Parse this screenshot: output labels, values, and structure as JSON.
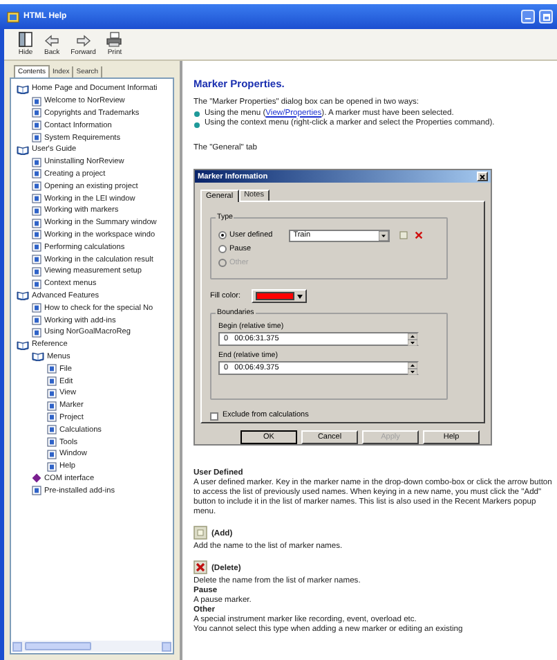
{
  "window": {
    "title": "HTML Help"
  },
  "toolbar": [
    {
      "label": "Hide",
      "kind": "hide"
    },
    {
      "label": "Back",
      "kind": "back"
    },
    {
      "label": "Forward",
      "kind": "forward"
    },
    {
      "label": "Print",
      "kind": "print"
    }
  ],
  "nav_tabs": [
    {
      "label": "Contents",
      "selected": true
    },
    {
      "label": "Index",
      "selected": false
    },
    {
      "label": "Search",
      "selected": false
    }
  ],
  "tree": [
    {
      "label": "Home Page and Document Informati",
      "kind": "book",
      "expanded": true,
      "children": [
        {
          "label": "Welcome to NorReview",
          "kind": "page"
        },
        {
          "label": "Copyrights and Trademarks",
          "kind": "page"
        },
        {
          "label": "Contact Information",
          "kind": "page"
        },
        {
          "label": "System Requirements",
          "kind": "page"
        }
      ]
    },
    {
      "label": "User's Guide",
      "kind": "book",
      "expanded": true,
      "children": [
        {
          "label": "Uninstalling NorReview",
          "kind": "page"
        },
        {
          "label": "Creating a project",
          "kind": "page"
        },
        {
          "label": "Opening an existing project",
          "kind": "page"
        },
        {
          "label": "Working in the LEI window",
          "kind": "page"
        },
        {
          "label": "Working with markers",
          "kind": "page"
        },
        {
          "label": "Working in the Summary window",
          "kind": "page"
        },
        {
          "label": "Working in the workspace windo",
          "kind": "page"
        },
        {
          "label": "Performing calculations",
          "kind": "page"
        },
        {
          "label": "Working in the calculation result",
          "kind": "page"
        },
        {
          "label": "Viewing measurement setup",
          "kind": "page"
        },
        {
          "label": "Context menus",
          "kind": "page"
        }
      ]
    },
    {
      "label": "Advanced Features",
      "kind": "book",
      "expanded": true,
      "children": [
        {
          "label": "How to check for the special No",
          "kind": "page"
        },
        {
          "label": "Working with add-ins",
          "kind": "page"
        },
        {
          "label": "Using NorGoalMacroReg",
          "kind": "page"
        }
      ]
    },
    {
      "label": "Reference",
      "kind": "book",
      "expanded": true,
      "children": [
        {
          "label": "Menus",
          "kind": "book",
          "expanded": true,
          "children": [
            {
              "label": "File",
              "kind": "page"
            },
            {
              "label": "Edit",
              "kind": "page"
            },
            {
              "label": "View",
              "kind": "page"
            },
            {
              "label": "Marker",
              "kind": "page"
            },
            {
              "label": "Project",
              "kind": "page"
            },
            {
              "label": "Calculations",
              "kind": "page"
            },
            {
              "label": "Tools",
              "kind": "page"
            },
            {
              "label": "Window",
              "kind": "page"
            },
            {
              "label": "Help",
              "kind": "page"
            }
          ]
        },
        {
          "label": "COM interface",
          "kind": "gem"
        },
        {
          "label": "Pre-installed add-ins",
          "kind": "page"
        }
      ]
    }
  ],
  "article": {
    "heading": "Marker Properties.",
    "intro": "The \"Marker Properties\" dialog box can be opened in two ways:",
    "bullets": [
      {
        "parts": [
          {
            "kind": "text",
            "text": "Using the menu ("
          },
          {
            "kind": "link",
            "text": "View/Properties"
          },
          {
            "kind": "text",
            "text": "). A marker must have been selected."
          }
        ]
      },
      {
        "parts": [
          {
            "kind": "text",
            "text": "Using the context menu (right-click a marker and select the Properties command)."
          }
        ]
      }
    ],
    "tab_caption": "The \"General\" tab",
    "dialog": {
      "title": "Marker Information",
      "tabs": [
        {
          "label": "General",
          "selected": true
        },
        {
          "label": "Notes",
          "selected": false
        }
      ],
      "type_group": {
        "label": "Type",
        "marker_name": "Train",
        "options": [
          {
            "label": "User defined",
            "selected": true,
            "disabled": false
          },
          {
            "label": "Pause",
            "selected": false,
            "disabled": false
          },
          {
            "label": "Other",
            "selected": false,
            "disabled": true
          }
        ]
      },
      "fill_color": {
        "label": "Fill color:",
        "color": "#ff0000"
      },
      "boundaries": {
        "label": "Boundaries",
        "fields": [
          {
            "label": "Begin (relative time)",
            "value": "0   00:06:31.375"
          },
          {
            "label": "End (relative time)",
            "value": "0   00:06:49.375"
          }
        ]
      },
      "exclude": {
        "label": "Exclude from calculations",
        "checked": false
      },
      "buttons": [
        {
          "label": "OK",
          "disabled": false,
          "default": true
        },
        {
          "label": "Cancel",
          "disabled": false,
          "default": false
        },
        {
          "label": "Apply",
          "disabled": true,
          "default": false
        },
        {
          "label": "Help",
          "disabled": false,
          "default": false
        }
      ]
    },
    "blocks": [
      {
        "kind": "heading",
        "text": "User Defined"
      },
      {
        "kind": "text",
        "text": "A user defined marker. Key in the marker name in the drop-down combo-box or click the arrow button to access the list of previously used names. When keying in a new name, you must click the \"Add\" button to include it in the list of marker names. This list is also used in the Recent Markers popup menu."
      },
      {
        "kind": "add_icon",
        "text": "(Add)"
      },
      {
        "kind": "text",
        "text": "Add the name to the list of marker names."
      },
      {
        "kind": "delete_icon",
        "text": "(Delete)"
      },
      {
        "kind": "text",
        "text": "Delete the name from the list of marker names."
      },
      {
        "kind": "heading",
        "text": "Pause"
      },
      {
        "kind": "text",
        "text": "A pause marker."
      },
      {
        "kind": "heading",
        "text": "Other"
      },
      {
        "kind": "text",
        "text": "A special instrument marker like recording, event, overload etc."
      },
      {
        "kind": "text",
        "text": "You cannot select this type when adding a new marker or editing an existing"
      }
    ]
  }
}
